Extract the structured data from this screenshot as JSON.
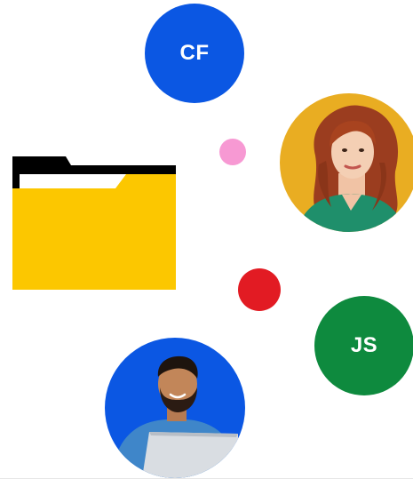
{
  "avatars": {
    "cf": {
      "initials": "CF",
      "color": "#0b57e3"
    },
    "js": {
      "initials": "JS",
      "color": "#0e8a3e"
    },
    "woman_photo": {
      "icon": "person-avatar-photo",
      "background": "#e9ad22"
    },
    "man_photo": {
      "icon": "person-avatar-photo",
      "background": "#0b57e3"
    }
  },
  "folder": {
    "icon": "folder-icon",
    "color": "#fcc700",
    "tab_color": "#000000"
  },
  "decor": {
    "pink_dot": "#f799d3",
    "red_dot": "#e21b23"
  }
}
